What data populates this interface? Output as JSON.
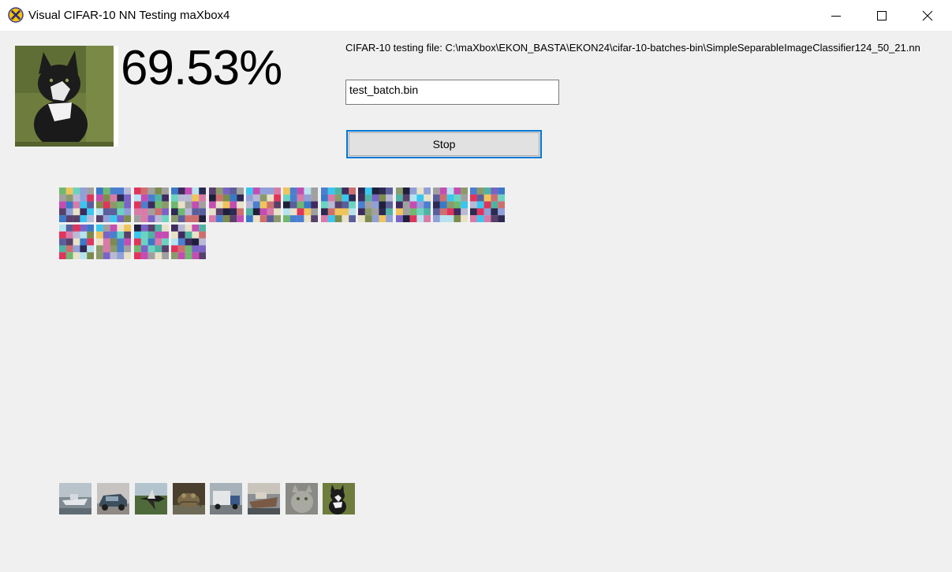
{
  "window": {
    "title": "Visual CIFAR-10 NN Testing maXbox4",
    "minimize_icon": "minimize-icon",
    "maximize_icon": "maximize-icon",
    "close_icon": "close-icon"
  },
  "main": {
    "accuracy": "69.53%",
    "file_label": "CIFAR-10 testing file: C:\\maXbox\\EKON_BASTA\\EKON24\\cifar-10-batches-bin\\SimpleSeparableImageClassifier124_50_21.nn",
    "file_input_value": "test_batch.bin",
    "stop_label": "Stop"
  },
  "filters": {
    "count": 16
  },
  "thumbnails": [
    {
      "name": "ship-thumbnail"
    },
    {
      "name": "car-thumbnail"
    },
    {
      "name": "plane-thumbnail"
    },
    {
      "name": "frog-thumbnail"
    },
    {
      "name": "truck-thumbnail"
    },
    {
      "name": "ship2-thumbnail"
    },
    {
      "name": "cat-thumbnail"
    },
    {
      "name": "cat2-thumbnail"
    }
  ],
  "colors": {
    "background": "#f0f0f0",
    "titlebar": "#ffffff",
    "button_border_focus": "#0078d7",
    "button_face": "#e1e1e1"
  }
}
